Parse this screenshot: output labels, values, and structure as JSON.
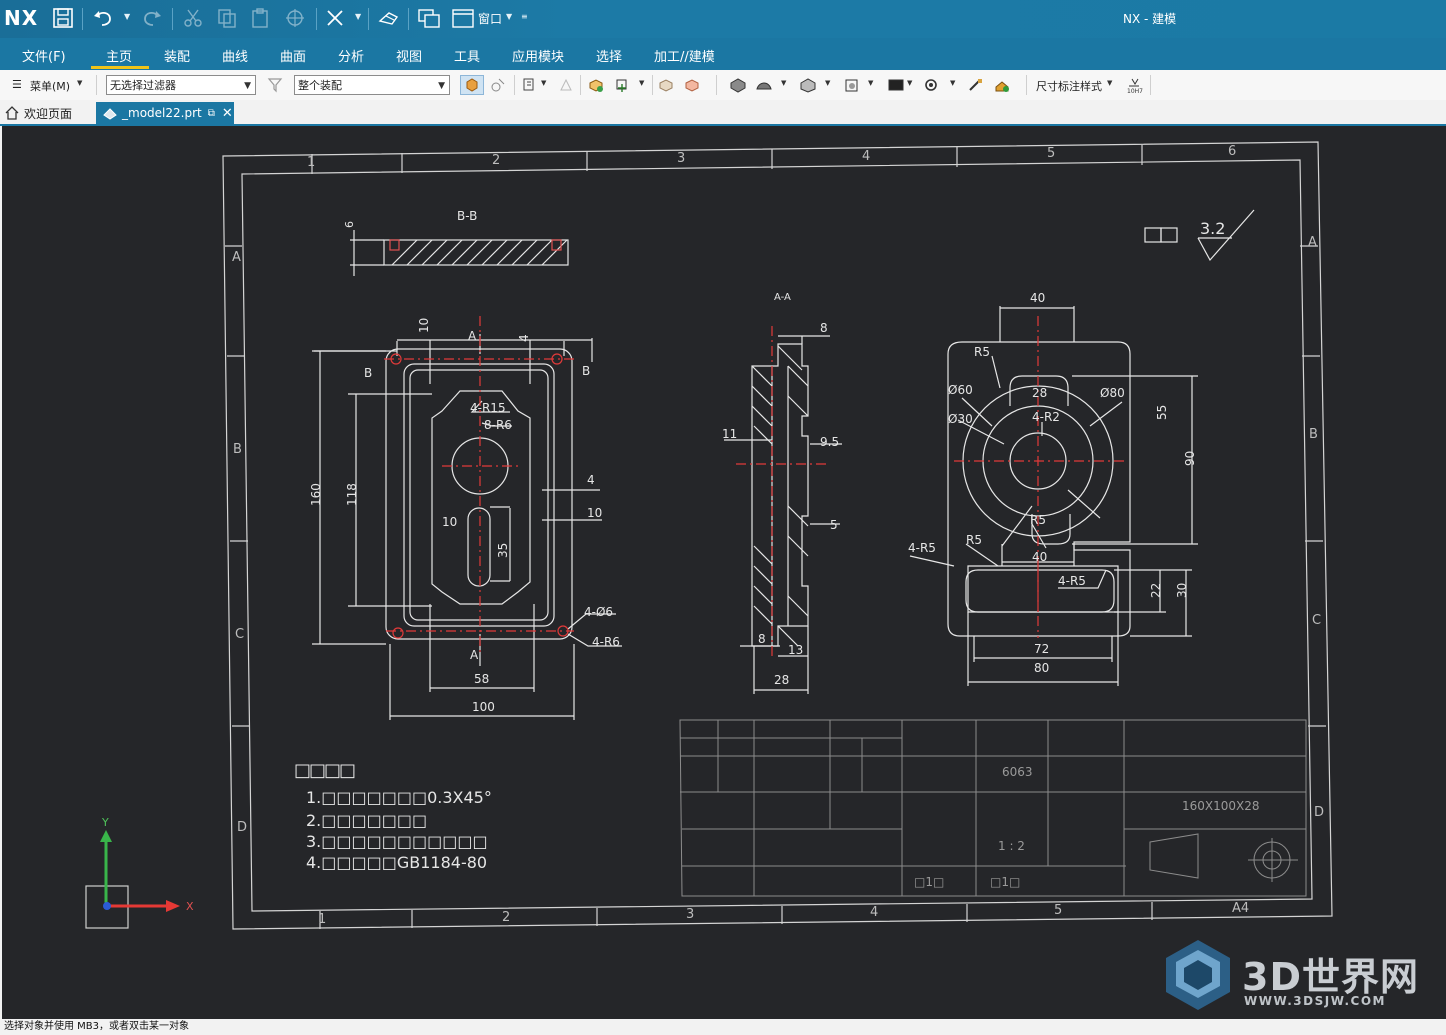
{
  "app": {
    "logo": "NX",
    "title": "NX - 建模",
    "window_menu": "窗口"
  },
  "ribbon_tabs": [
    "文件(F)",
    "主页",
    "装配",
    "曲线",
    "曲面",
    "分析",
    "视图",
    "工具",
    "应用模块",
    "选择",
    "加工//建模"
  ],
  "toolbar": {
    "menu_label": "菜单(M)",
    "filter_value": "无选择过滤器",
    "scope_value": "整个装配",
    "dimension_style": "尺寸标注样式"
  },
  "doc_tabs": {
    "welcome": "欢迎页面",
    "model": "_model22.prt"
  },
  "status_text": "选择对象并使用 MB3，或者双击某一对象",
  "watermark": {
    "title": "3D世界网",
    "url": "WWW.3DSJW.COM"
  },
  "drawing": {
    "zone_cols": [
      "1",
      "2",
      "3",
      "4",
      "5",
      "6"
    ],
    "zone_rows": [
      "A",
      "B",
      "C",
      "D"
    ],
    "sheet_size": "A4",
    "section_bb": "B-B",
    "section_aa": "A-A",
    "roughness": "3.2",
    "front_dims": [
      "10",
      "4",
      "4-R15",
      "8-R6",
      "160",
      "118",
      "4",
      "10",
      "10",
      "35",
      "4-Ø6",
      "4-R6",
      "58",
      "100"
    ],
    "front_labels": [
      "A",
      "A",
      "B",
      "B"
    ],
    "bb_dim": "6",
    "section_dims": [
      "8",
      "11",
      "9.5",
      "5",
      "8",
      "13",
      "28"
    ],
    "right_dims": [
      "40",
      "R5",
      "Ø60",
      "28",
      "Ø80",
      "Ø30",
      "4-R2",
      "55",
      "90",
      "R5",
      "R5",
      "4-R5",
      "40",
      "4-R5",
      "22",
      "30",
      "72",
      "80"
    ],
    "notes_title": "□□□□",
    "notes": [
      "1.□□□□□□□0.3X45°",
      "2.□□□□□□□",
      "3.□□□□□□□□□□□",
      "4.□□□□□GB1184-80"
    ],
    "title_block": {
      "material": "6063",
      "size": "160X100X28",
      "scale": "1 : 2",
      "sheet_a": "□1□",
      "sheet_b": "□1□"
    },
    "axes": {
      "x": "X",
      "y": "Y"
    }
  }
}
